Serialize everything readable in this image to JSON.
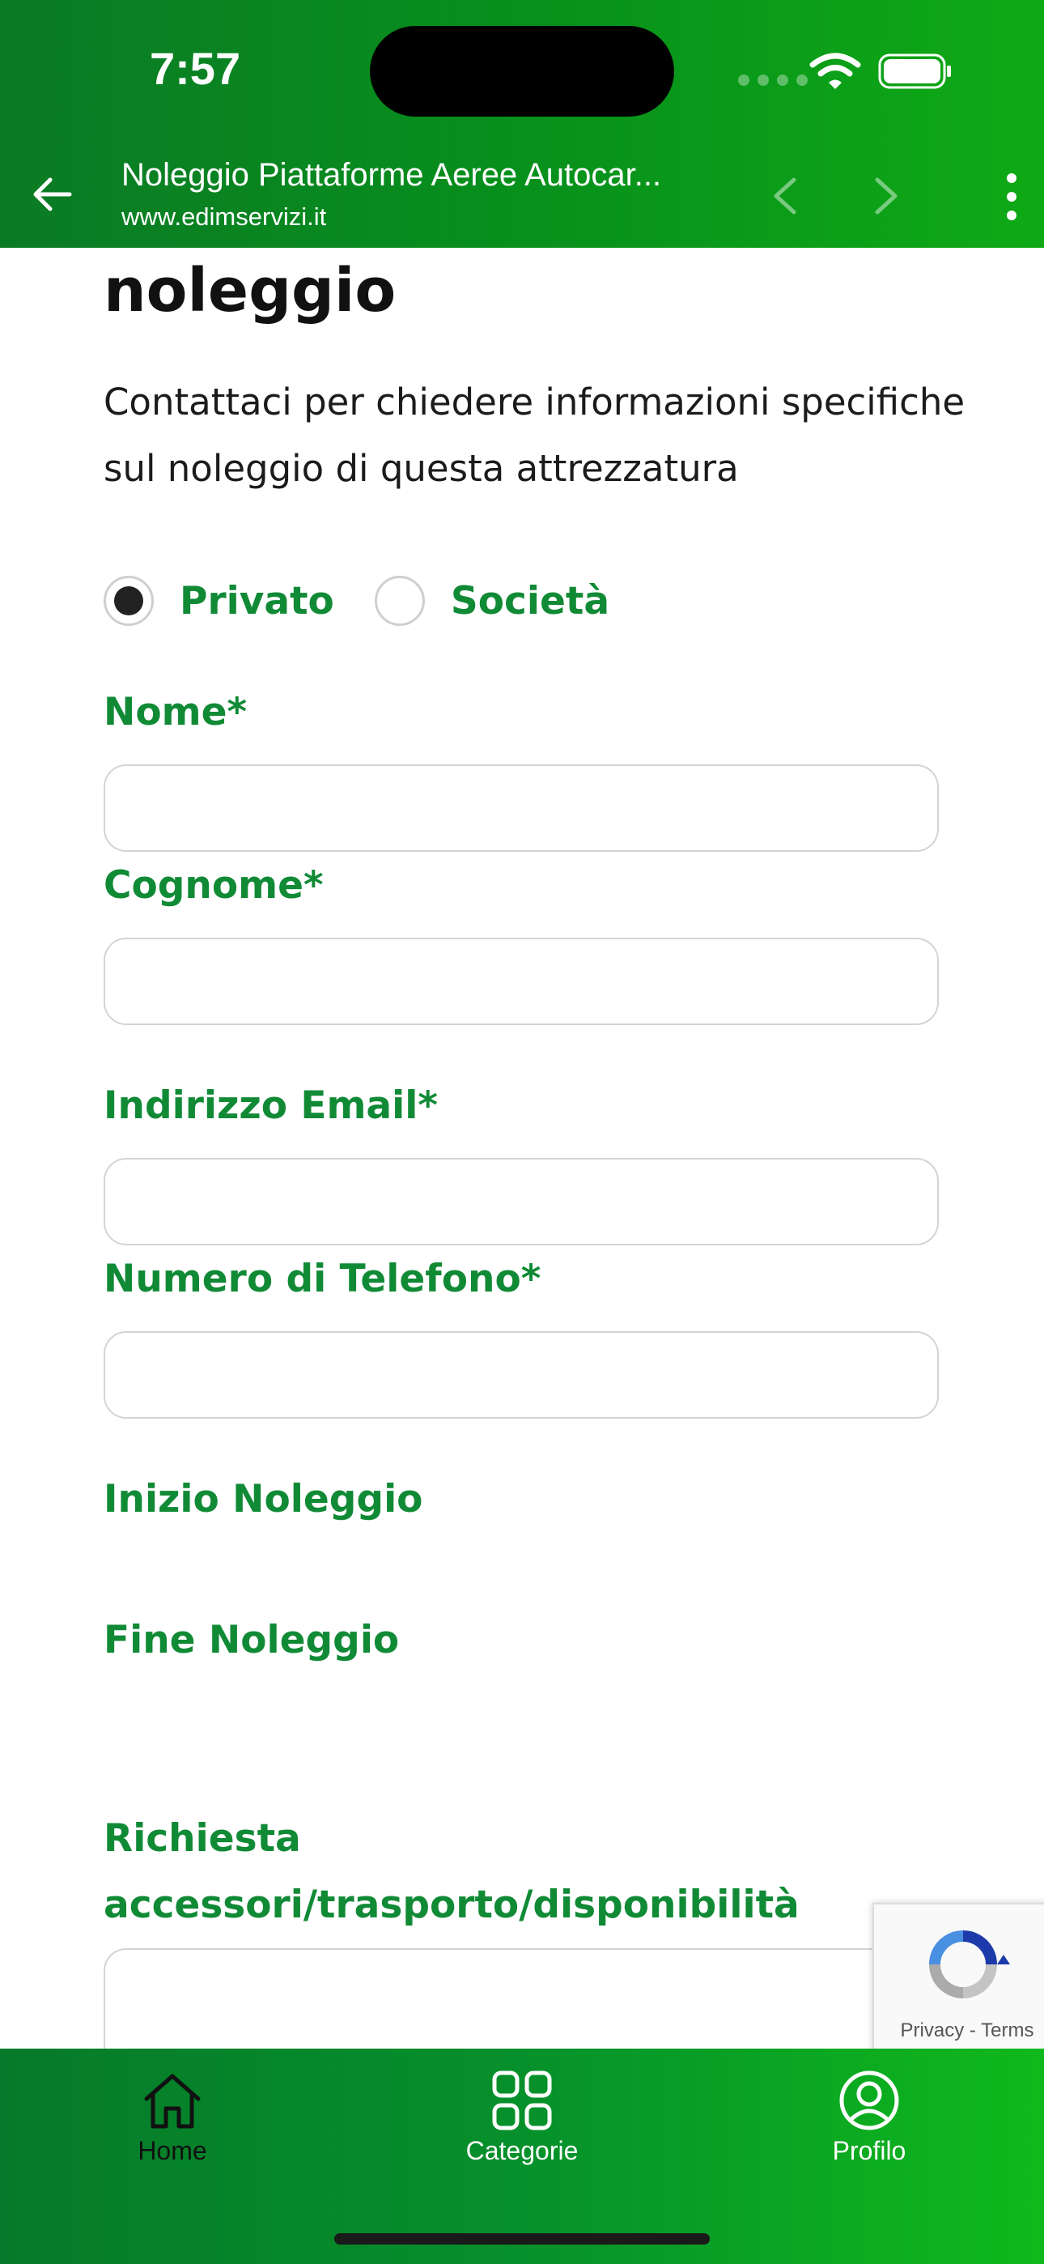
{
  "status_bar": {
    "time": "7:57"
  },
  "browser_bar": {
    "title": "Noleggio Piattaforme Aeree Autocar...",
    "url": "www.edimservizi.it"
  },
  "form": {
    "heading": "Chiedi informazioni sul noleggio",
    "intro": "Contattaci per chiedere informazioni specifiche sul noleggio di questa attrezzatura",
    "customer_type": {
      "options": [
        "Privato",
        "Società"
      ],
      "selected": "Privato"
    },
    "fields": {
      "nome": {
        "label": "Nome*",
        "value": ""
      },
      "cognome": {
        "label": "Cognome*",
        "value": ""
      },
      "email": {
        "label": "Indirizzo Email*",
        "value": ""
      },
      "telefono": {
        "label": "Numero di Telefono*",
        "value": ""
      },
      "inizio": {
        "label": "Inizio Noleggio"
      },
      "fine": {
        "label": "Fine Noleggio"
      },
      "richiesta": {
        "label": "Richiesta accessori/trasporto/disponibilità (facoltativo)",
        "value": ""
      }
    }
  },
  "recaptcha": {
    "links": "Privacy - Terms"
  },
  "bottom_nav": {
    "items": [
      {
        "label": "Home",
        "icon": "home-icon",
        "active": true
      },
      {
        "label": "Categorie",
        "icon": "grid-icon",
        "active": false
      },
      {
        "label": "Profilo",
        "icon": "user-circle-icon",
        "active": false
      }
    ]
  },
  "colors": {
    "brand_green": "#0b8a2a",
    "label_green": "#118a36"
  }
}
